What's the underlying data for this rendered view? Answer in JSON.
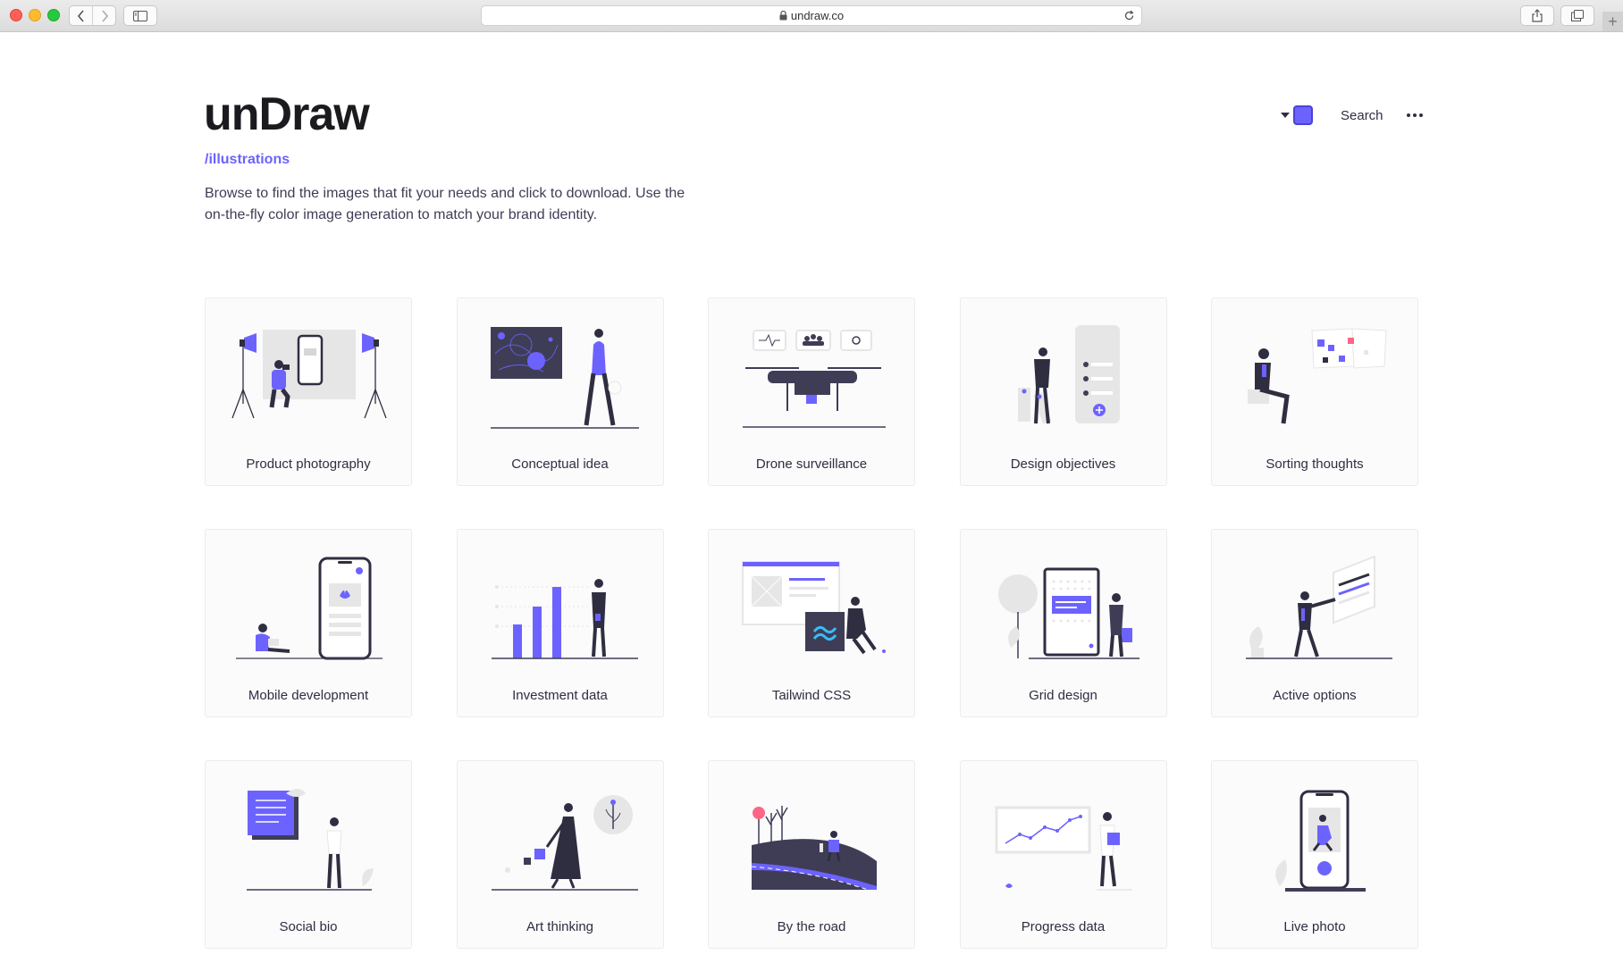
{
  "browser": {
    "url": "undraw.co"
  },
  "header": {
    "logo": "unDraw",
    "subpath": "/illustrations",
    "intro": "Browse to find the images that fit your needs and click to download. Use the on-the-fly color image generation to match your brand identity.",
    "search_label": "Search",
    "accent_color": "#6c63ff"
  },
  "illustrations": [
    {
      "title": "Product photography"
    },
    {
      "title": "Conceptual idea"
    },
    {
      "title": "Drone surveillance"
    },
    {
      "title": "Design objectives"
    },
    {
      "title": "Sorting thoughts"
    },
    {
      "title": "Mobile development"
    },
    {
      "title": "Investment data"
    },
    {
      "title": "Tailwind CSS"
    },
    {
      "title": "Grid design"
    },
    {
      "title": "Active options"
    },
    {
      "title": "Social bio"
    },
    {
      "title": "Art thinking"
    },
    {
      "title": "By the road"
    },
    {
      "title": "Progress data"
    },
    {
      "title": "Live photo"
    }
  ],
  "colors": {
    "accent": "#6c63ff",
    "dark": "#2f2e41",
    "light_gray": "#e6e6e6"
  }
}
